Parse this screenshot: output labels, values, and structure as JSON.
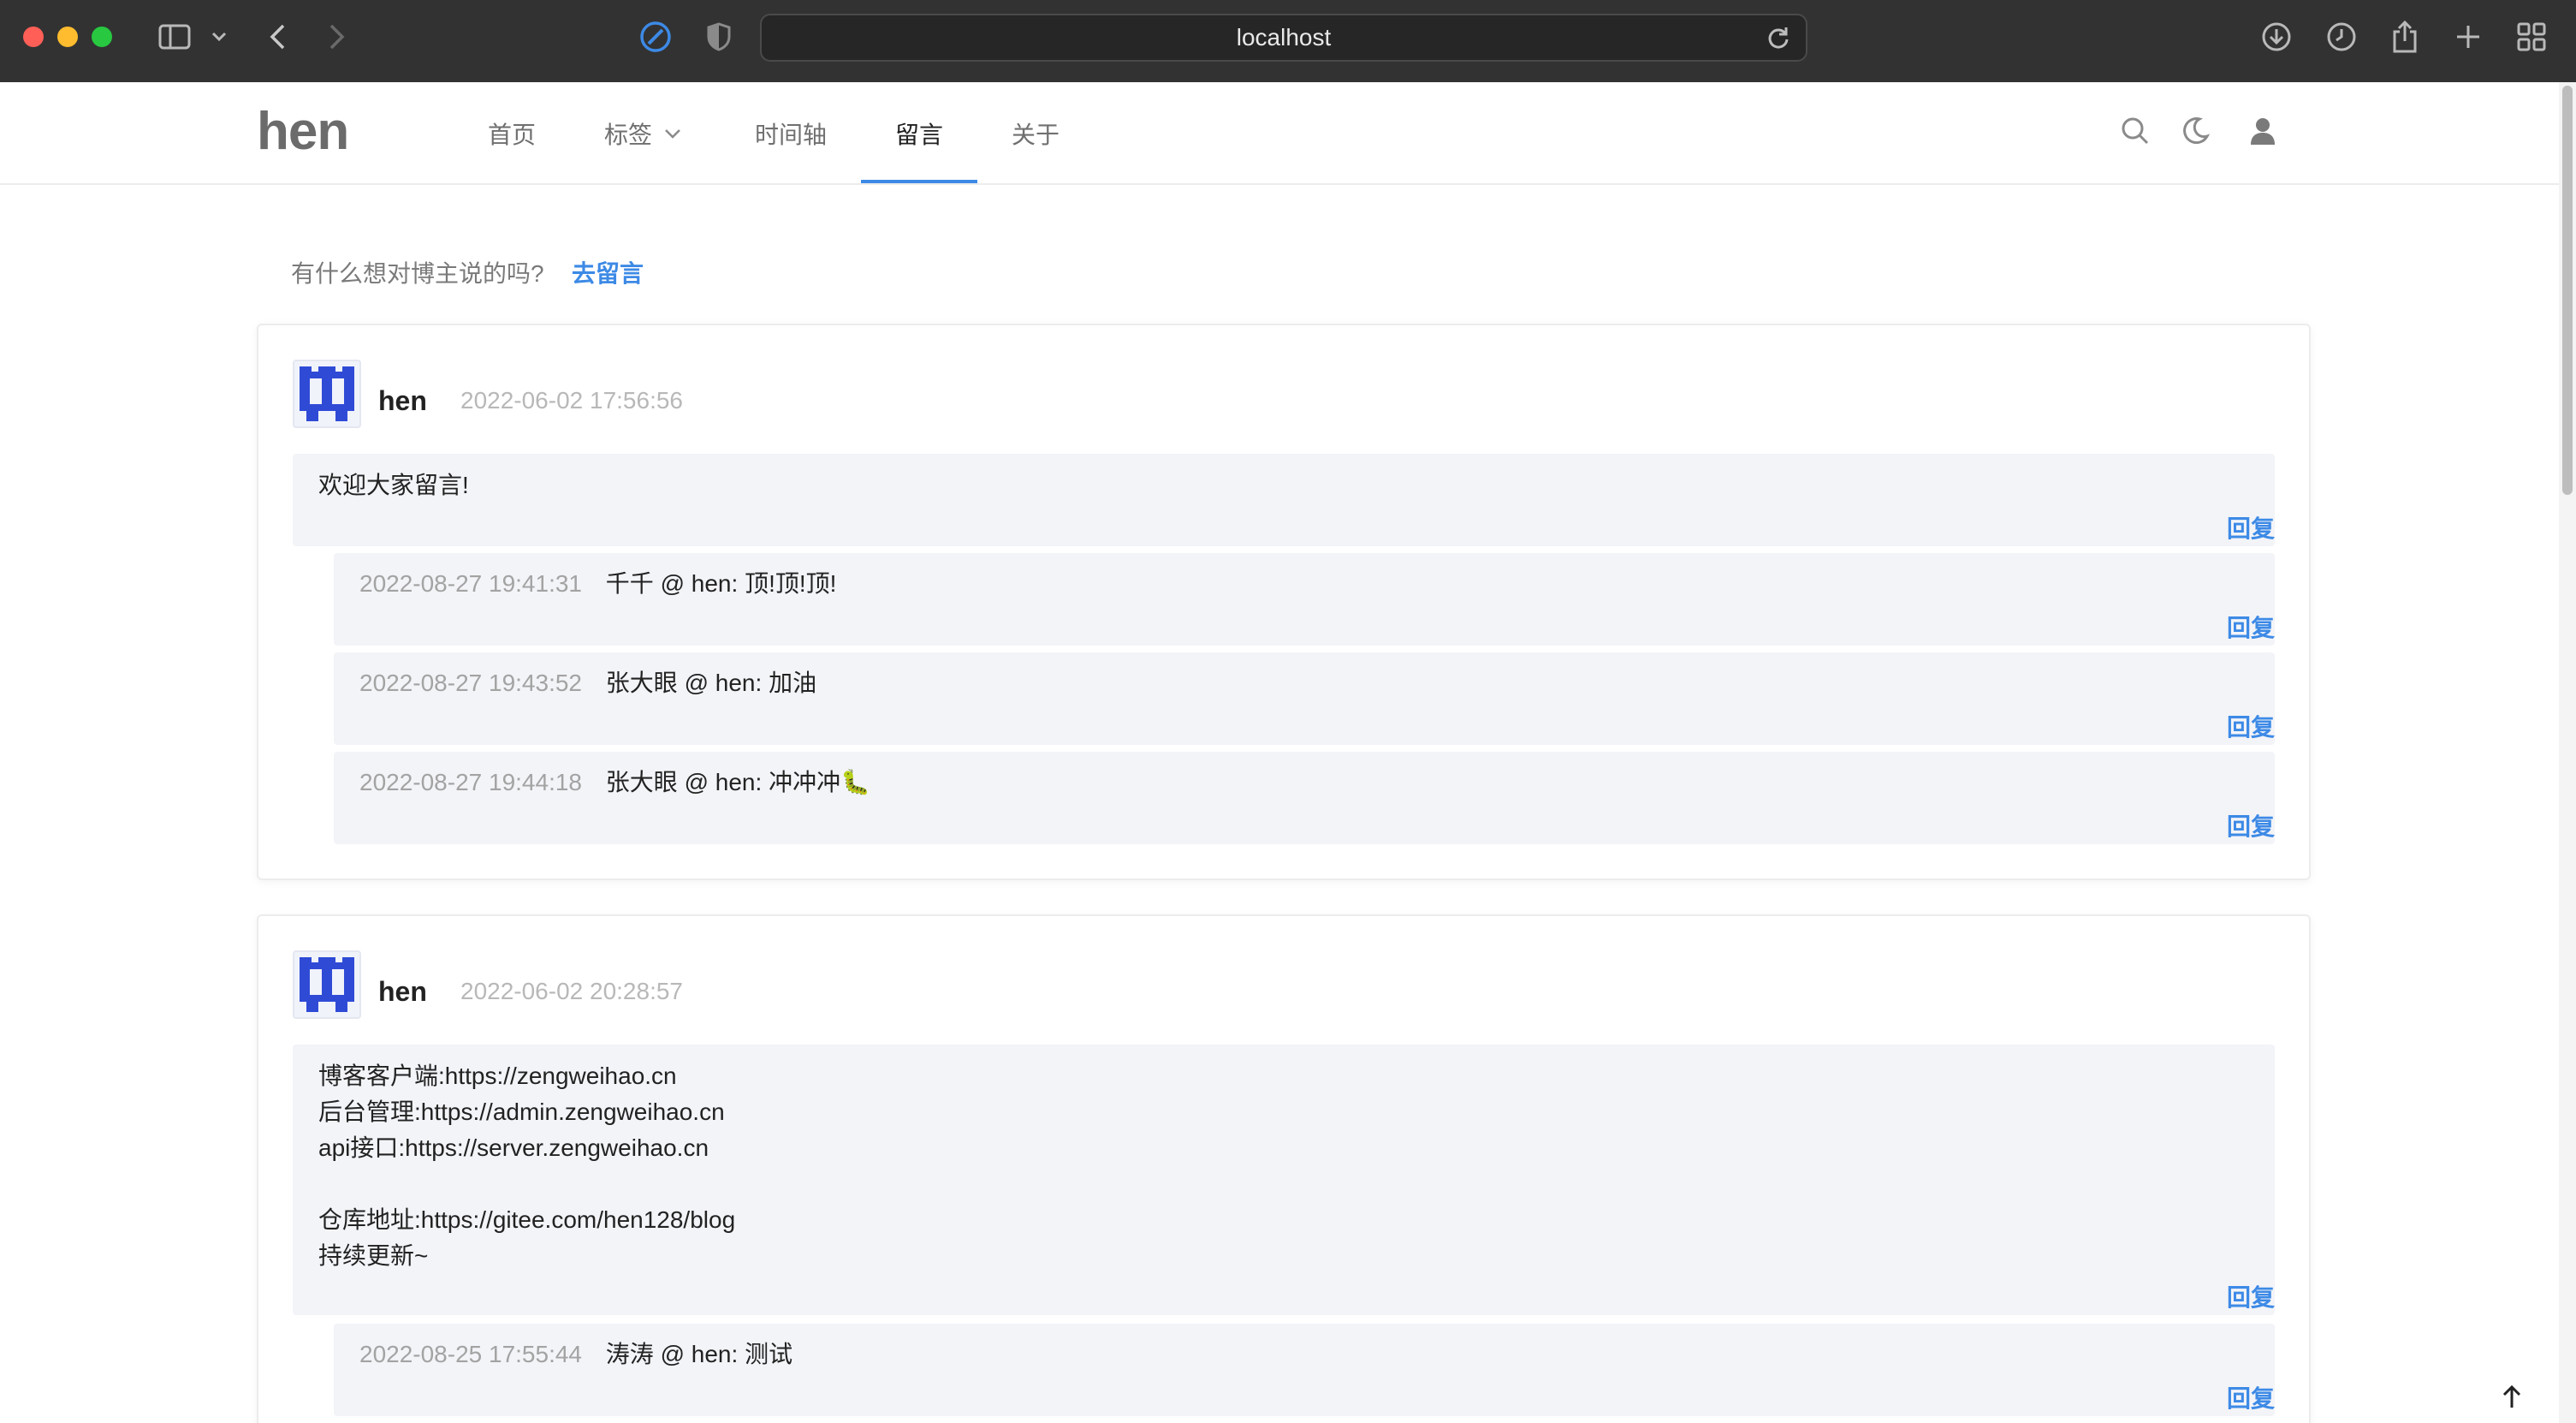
{
  "browser": {
    "url": "localhost"
  },
  "site": {
    "logo": "hen",
    "nav": [
      {
        "label": "首页"
      },
      {
        "label": "标签"
      },
      {
        "label": "时间轴"
      },
      {
        "label": "留言",
        "active": true
      },
      {
        "label": "关于"
      }
    ],
    "accent_color": "#3d8ae6"
  },
  "board": {
    "prompt": "有什么想对博主说的吗?",
    "prompt_link": "去留言",
    "reply_label": "回复"
  },
  "messages": [
    {
      "author": "hen",
      "time": "2022-06-02 17:56:56",
      "content": "欢迎大家留言!",
      "replies": [
        {
          "time": "2022-08-27 19:41:31",
          "from": "千千",
          "to": "hen",
          "content": "顶!顶!顶!"
        },
        {
          "time": "2022-08-27 19:43:52",
          "from": "张大眼",
          "to": "hen",
          "content": "加油"
        },
        {
          "time": "2022-08-27 19:44:18",
          "from": "张大眼",
          "to": "hen",
          "content": "冲冲冲",
          "emoji": "🐛"
        }
      ]
    },
    {
      "author": "hen",
      "time": "2022-06-02 20:28:57",
      "content": "博客客户端:https://zengweihao.cn\n后台管理:https://admin.zengweihao.cn\napi接口:https://server.zengweihao.cn\n\n仓库地址:https://gitee.com/hen128/blog\n持续更新~",
      "replies": [
        {
          "time": "2022-08-25 17:55:44",
          "from": "涛涛",
          "to": "hen",
          "content": "测试"
        }
      ]
    }
  ]
}
